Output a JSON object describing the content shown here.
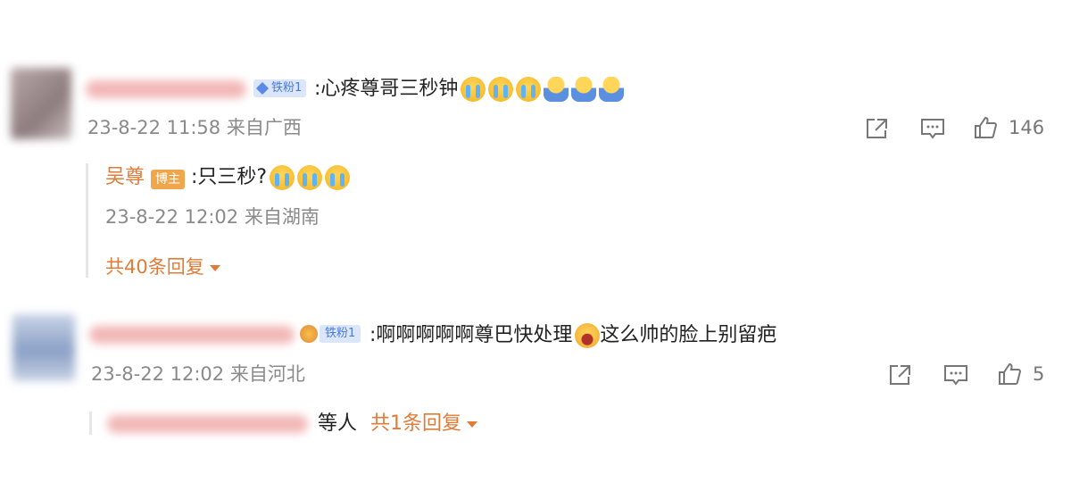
{
  "comments": [
    {
      "fan_badge": "铁粉1",
      "text": ":心疼尊哥三秒钟",
      "meta": "23-8-22 11:58 来自广西",
      "likes": "146",
      "reply": {
        "author": "吴尊",
        "author_badge": "博主",
        "text": ":只三秒?",
        "meta": "23-8-22 12:02 来自湖南"
      },
      "more_replies": "共40条回复"
    },
    {
      "fan_badge": "铁粉1",
      "text_before": ":啊啊啊啊啊尊巴快处理",
      "text_after": "这么帅的脸上别留疤",
      "meta": "23-8-22 12:02 来自河北",
      "likes": "5",
      "reply_preview": "等人",
      "more_replies": "共1条回复"
    }
  ],
  "icons": [
    "share-icon",
    "comment-icon",
    "like-icon",
    "crying-emoji",
    "doge-emoji",
    "screaming-emoji",
    "caret-down-icon"
  ],
  "colors": {
    "accent": "#e07c3a",
    "meta_gray": "#8a8a8a",
    "badge_blue": "#4a7ad8",
    "host_badge": "#f0a64a"
  }
}
